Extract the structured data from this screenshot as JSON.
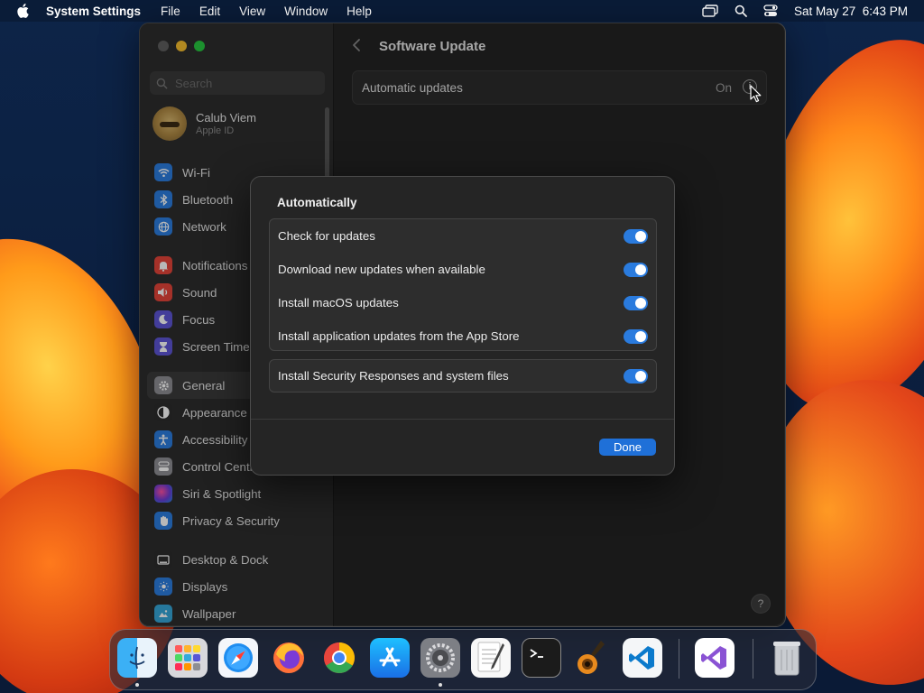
{
  "colors": {
    "accent": "#1f70d8",
    "toggle_on": "#2a7bde",
    "window_bg": "#232323"
  },
  "menubar": {
    "app_name": "System Settings",
    "menus": [
      "File",
      "Edit",
      "View",
      "Window",
      "Help"
    ],
    "datetime": "Sat May 27  6:43 PM",
    "status_icons": [
      "screen-mirroring-icon",
      "spotlight-search-icon",
      "control-center-icon"
    ]
  },
  "sidebar": {
    "search_placeholder": "Search",
    "account": {
      "name": "Calub Viem",
      "subtitle": "Apple ID"
    },
    "items": [
      {
        "label": "Wi-Fi",
        "icon": "wifi-icon",
        "color": "#2b7de0"
      },
      {
        "label": "Bluetooth",
        "icon": "bluetooth-icon",
        "color": "#2b7de0"
      },
      {
        "label": "Network",
        "icon": "globe-icon",
        "color": "#2b7de0"
      },
      {
        "label": "Notifications",
        "icon": "bell-icon",
        "color": "#e5453a"
      },
      {
        "label": "Sound",
        "icon": "speaker-icon",
        "color": "#e5453a"
      },
      {
        "label": "Focus",
        "icon": "moon-icon",
        "color": "#5d55d6"
      },
      {
        "label": "Screen Time",
        "icon": "hourglass-icon",
        "color": "#5d55d6"
      },
      {
        "label": "General",
        "icon": "gear-icon",
        "color": "#8e8e93"
      },
      {
        "label": "Appearance",
        "icon": "appearance-icon",
        "color": "#2c2c2c"
      },
      {
        "label": "Accessibility",
        "icon": "accessibility-icon",
        "color": "#2b7de0"
      },
      {
        "label": "Control Centre",
        "icon": "control-centre-icon",
        "color": "#8e8e93"
      },
      {
        "label": "Siri & Spotlight",
        "icon": "siri-icon",
        "color": "#3a2a6a"
      },
      {
        "label": "Privacy & Security",
        "icon": "hand-icon",
        "color": "#2b7de0"
      },
      {
        "label": "Desktop & Dock",
        "icon": "desktop-dock-icon",
        "color": "#2c2c2c"
      },
      {
        "label": "Displays",
        "icon": "displays-icon",
        "color": "#2b7de0"
      },
      {
        "label": "Wallpaper",
        "icon": "wallpaper-icon",
        "color": "#35a7d8"
      }
    ]
  },
  "content": {
    "title": "Software Update",
    "automatic_updates": {
      "label": "Automatic updates",
      "value": "On"
    }
  },
  "sheet": {
    "title": "Automatically",
    "options": [
      {
        "label": "Check for updates",
        "on": true
      },
      {
        "label": "Download new updates when available",
        "on": true
      },
      {
        "label": "Install macOS updates",
        "on": true
      },
      {
        "label": "Install application updates from the App Store",
        "on": true
      }
    ],
    "security": {
      "label": "Install Security Responses and system files",
      "on": true
    },
    "done_label": "Done"
  },
  "dock": {
    "apps": [
      {
        "name": "Finder",
        "icon": "finder-icon",
        "running": true
      },
      {
        "name": "Launchpad",
        "icon": "launchpad-icon",
        "running": false
      },
      {
        "name": "Safari",
        "icon": "safari-icon",
        "running": false
      },
      {
        "name": "Firefox",
        "icon": "firefox-icon",
        "running": false
      },
      {
        "name": "Chrome",
        "icon": "chrome-icon",
        "running": false
      },
      {
        "name": "App Store",
        "icon": "app-store-icon",
        "running": false
      },
      {
        "name": "System Settings",
        "icon": "system-settings-icon",
        "running": true
      },
      {
        "name": "TextEdit",
        "icon": "textedit-icon",
        "running": false
      },
      {
        "name": "Terminal",
        "icon": "terminal-icon",
        "running": false
      },
      {
        "name": "GarageBand",
        "icon": "garageband-icon",
        "running": false
      },
      {
        "name": "Visual Studio Code",
        "icon": "vscode-icon",
        "running": false
      },
      {
        "name": "Visual Studio",
        "icon": "visual-studio-icon",
        "running": false
      },
      {
        "name": "Trash",
        "icon": "trash-icon",
        "running": false
      }
    ]
  }
}
